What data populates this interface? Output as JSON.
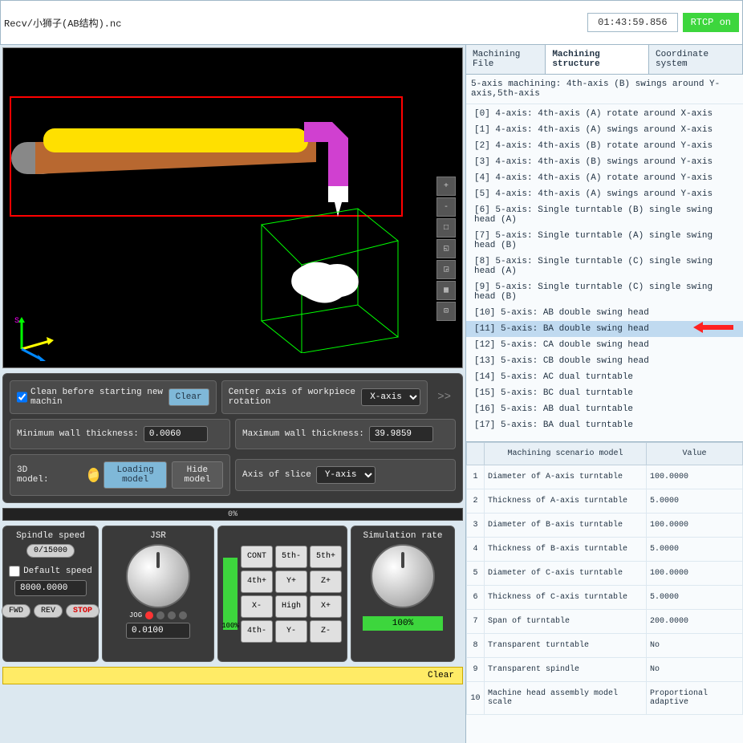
{
  "header": {
    "file_path": "Recv/小狮子(AB结构).nc",
    "time": "01:43:59.856",
    "rtcp": "RTCP on"
  },
  "viewport": {
    "tools": [
      "+",
      "-",
      "□",
      "◱",
      "◲",
      "▦",
      "⊡"
    ]
  },
  "panels": {
    "clean_label": "Clean before starting new machin",
    "clear_btn": "Clear",
    "center_axis_label": "Center axis of workpiece rotation",
    "center_axis_value": "X-axis",
    "min_wall_label": "Minimum wall thickness:",
    "min_wall_value": "0.0060",
    "max_wall_label": "Maximum wall thickness:",
    "max_wall_value": "39.9859",
    "model_label": "3D model:",
    "loading_btn": "Loading model",
    "hide_btn": "Hide model",
    "slice_label": "Axis of slice",
    "slice_value": "Y-axis"
  },
  "progress": "0%",
  "controls": {
    "spindle_title": "Spindle speed",
    "spindle_value": "0/15000",
    "default_speed_label": "Default speed",
    "default_speed_value": "8000.0000",
    "fwd": "FWD",
    "rev": "REV",
    "stop": "STOP",
    "jsr_title": "JSR",
    "jsr_pct": "100%",
    "jog_label": "JOG",
    "jog_value": "0.0100",
    "keys": [
      "CONT",
      "5th-",
      "5th+",
      "4th+",
      "Y+",
      "Z+",
      "X-",
      "High",
      "X+",
      "4th-",
      "Y-",
      "Z-"
    ],
    "sim_title": "Simulation rate",
    "sim_pct": "100%"
  },
  "clear_bar": "Clear",
  "tabs": {
    "t1": "Machining File",
    "t2": "Machining structure",
    "t3": "Coordinate system"
  },
  "desc": "5-axis machining: 4th-axis (B) swings around Y-axis,5th-axis",
  "struct": [
    "[0] 4-axis: 4th-axis (A) rotate around X-axis",
    "[1] 4-axis: 4th-axis (A) swings around X-axis",
    "[2] 4-axis: 4th-axis (B) rotate around Y-axis",
    "[3] 4-axis: 4th-axis (B) swings around Y-axis",
    "[4] 4-axis: 4th-axis (A) rotate around Y-axis",
    "[5] 4-axis: 4th-axis (A) swings around Y-axis",
    "[6] 5-axis: Single turntable (B) single swing head (A)",
    "[7] 5-axis: Single turntable (A) single swing head (B)",
    "[8] 5-axis: Single turntable (C) single swing head (A)",
    "[9] 5-axis: Single turntable (C) single swing head (B)",
    "[10] 5-axis: AB double swing head",
    "[11] 5-axis: BA double swing head",
    "[12] 5-axis: CA double swing head",
    "[13] 5-axis: CB double swing head",
    "[14] 5-axis: AC dual turntable",
    "[15] 5-axis: BC dual turntable",
    "[16] 5-axis: AB dual turntable",
    "[17] 5-axis: BA dual turntable"
  ],
  "struct_selected": 11,
  "params_header": {
    "model": "Machining scenario model",
    "value": "Value"
  },
  "params": [
    {
      "i": "1",
      "name": "Diameter of A-axis turntable",
      "value": "100.0000"
    },
    {
      "i": "2",
      "name": "Thickness of A-axis turntable",
      "value": "5.0000"
    },
    {
      "i": "3",
      "name": "Diameter of B-axis turntable",
      "value": "100.0000"
    },
    {
      "i": "4",
      "name": "Thickness of B-axis turntable",
      "value": "5.0000"
    },
    {
      "i": "5",
      "name": "Diameter of C-axis turntable",
      "value": "100.0000"
    },
    {
      "i": "6",
      "name": "Thickness of C-axis turntable",
      "value": "5.0000"
    },
    {
      "i": "7",
      "name": "Span of turntable",
      "value": "200.0000"
    },
    {
      "i": "8",
      "name": "Transparent turntable",
      "value": "No"
    },
    {
      "i": "9",
      "name": "Transparent spindle",
      "value": "No"
    },
    {
      "i": "10",
      "name": "Machine head assembly model scale",
      "value": "Proportional adaptive"
    }
  ]
}
